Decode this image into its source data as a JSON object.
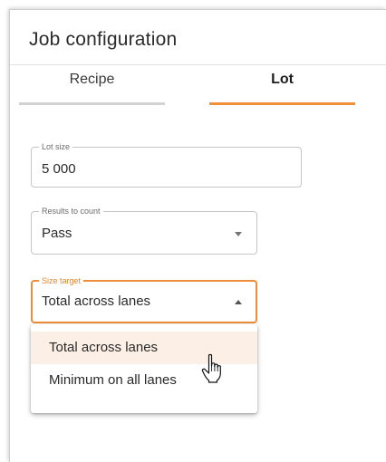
{
  "dialog": {
    "title": "Job configuration"
  },
  "tabs": [
    {
      "label": "Recipe",
      "active": false
    },
    {
      "label": "Lot",
      "active": true
    }
  ],
  "accent_color": "#f0913a",
  "fields": {
    "lot_size": {
      "label": "Lot size",
      "value": "5 000"
    },
    "results_to_count": {
      "label": "Results to count",
      "value": "Pass"
    },
    "size_target": {
      "label": "Size target",
      "value": "Total across lanes"
    }
  },
  "dropdown": {
    "options": [
      "Total across lanes",
      "Minimum on all lanes"
    ],
    "highlighted": "Total across lanes"
  },
  "cursor": {
    "icon": "hand-pointer-icon"
  }
}
